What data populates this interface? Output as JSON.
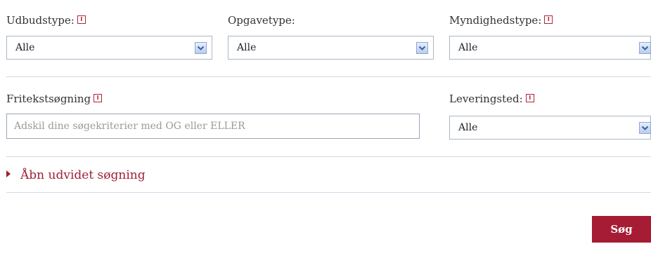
{
  "filters": {
    "udbudstype": {
      "label": "Udbudstype:",
      "value": "Alle",
      "info_glyph": "I"
    },
    "opgavetype": {
      "label": "Opgavetype:",
      "value": "Alle"
    },
    "myndighedstype": {
      "label": "Myndighedstype:",
      "value": "Alle",
      "info_glyph": "I"
    },
    "fritekst": {
      "label": "Fritekstsøgning",
      "placeholder": "Adskil dine søgekriterier med OG eller ELLER",
      "value": "",
      "info_glyph": "I"
    },
    "leveringsted": {
      "label": "Leveringsted:",
      "value": "Alle",
      "info_glyph": "I"
    }
  },
  "advanced_search": {
    "label": "Åbn udvidet søgning"
  },
  "search_button": {
    "label": "Søg"
  },
  "colors": {
    "accent": "#a51c34",
    "link": "#a01f36",
    "divider": "#cfdce8",
    "select_border": "#a9b7c6"
  },
  "icons": {
    "info": "info-icon",
    "dropdown": "chevron-down-icon",
    "expand": "triangle-right-icon"
  }
}
